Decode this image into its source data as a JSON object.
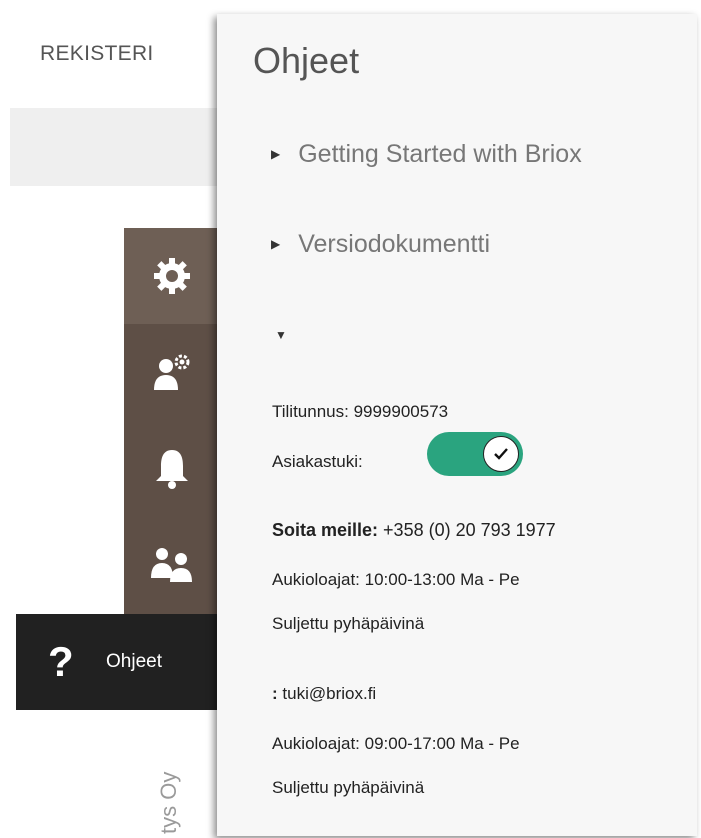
{
  "topbar": {
    "tab_label": "REKISTERI"
  },
  "sidebar": {
    "company_fragment": "tys Oy",
    "help_item_label": "Ohjeet"
  },
  "help_panel": {
    "title": "Ohjeet",
    "links": [
      "Getting Started with Briox",
      "Versiodokumentti"
    ],
    "account_label": "Tilitunnus: 9999900573",
    "support_label": "Asiakastuki:",
    "support_enabled": true,
    "call_label": "Soita meille:",
    "phone": "+358 (0) 20 793 1977",
    "phone_hours": "Aukioloajat: 10:00-13:00 Ma - Pe",
    "phone_closed": "Suljettu pyhäpäivinä",
    "email_prefix": ":",
    "email": "tuki@briox.fi",
    "email_hours": "Aukioloajat: 09:00-17:00 Ma - Pe",
    "email_closed": "Suljettu pyhäpäivinä"
  },
  "icons": {
    "settings": "gear-icon",
    "user_settings": "user-gear-icon",
    "notifications": "bell-icon",
    "users": "users-icon",
    "help": "question-icon"
  },
  "colors": {
    "rail": "#5e4f46",
    "rail_active": "#6e5f55",
    "help_item": "#212121",
    "toggle_on": "#2aa47f"
  }
}
